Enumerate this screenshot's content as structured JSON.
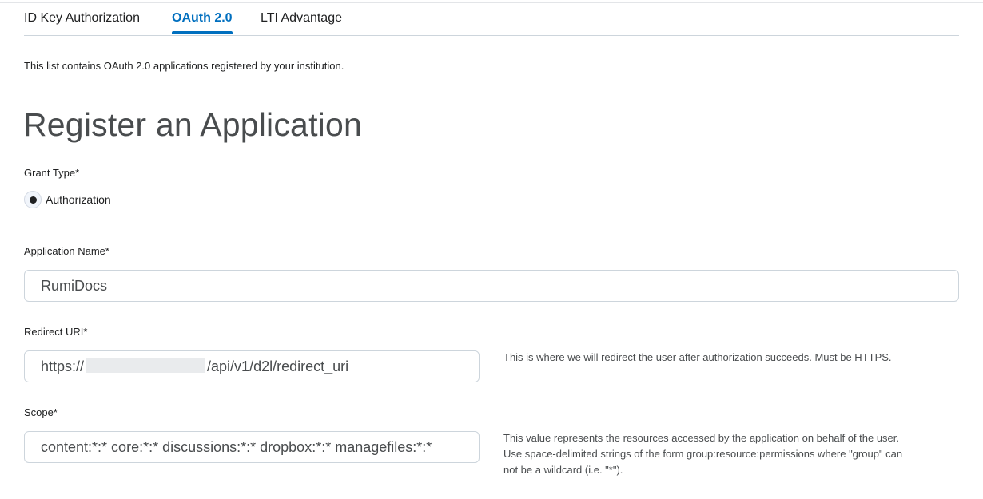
{
  "tabs": [
    {
      "label": "ID Key Authorization",
      "active": false
    },
    {
      "label": "OAuth 2.0",
      "active": true
    },
    {
      "label": "LTI Advantage",
      "active": false
    }
  ],
  "intro_text": "This list contains OAuth 2.0 applications registered by your institution.",
  "page_title": "Register an Application",
  "grant_type": {
    "label": "Grant Type*",
    "option_label": "Authorization",
    "selected": true
  },
  "application_name": {
    "label": "Application Name*",
    "value": "RumiDocs"
  },
  "redirect_uri": {
    "label": "Redirect URI*",
    "value_prefix": "https://",
    "value_suffix": "/api/v1/d2l/redirect_uri",
    "help": "This is where we will redirect the user after authorization succeeds. Must be HTTPS."
  },
  "scope": {
    "label": "Scope*",
    "value": "content:*:* core:*:* discussions:*:* dropbox:*:* managefiles:*:*",
    "help_lines": [
      "This value represents the resources accessed by the application on behalf of the user.",
      "Use space-delimited strings of the form group:resource:permissions where \"group\" can",
      "not be a wildcard (i.e. \"*\")."
    ]
  },
  "colors": {
    "accent": "#006fbf",
    "text": "#202122",
    "heading": "#494c4e",
    "border": "#cdd5dc"
  }
}
